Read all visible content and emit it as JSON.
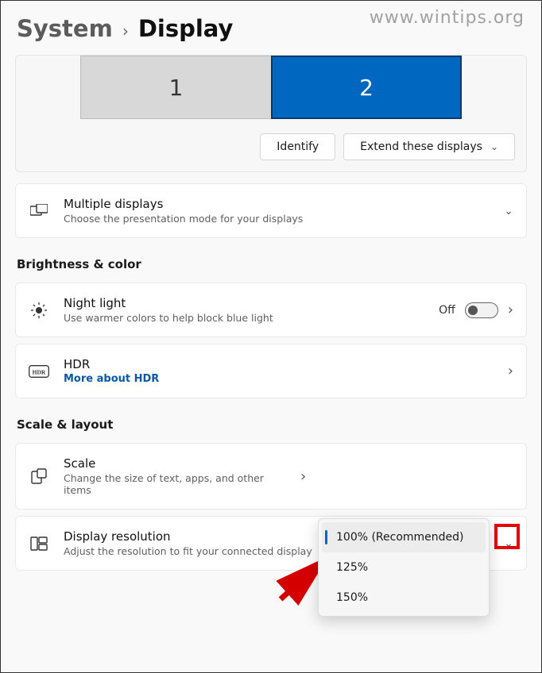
{
  "watermark": "www.wintips.org",
  "breadcrumb": {
    "system": "System",
    "display": "Display"
  },
  "monitors": {
    "m1": "1",
    "m2": "2",
    "identify": "Identify",
    "extend": "Extend these displays"
  },
  "sections": {
    "brightness": "Brightness & color",
    "scale": "Scale & layout"
  },
  "multiple": {
    "title": "Multiple displays",
    "sub": "Choose the presentation mode for your displays"
  },
  "night": {
    "title": "Night light",
    "sub": "Use warmer colors to help block blue light",
    "state": "Off"
  },
  "hdr": {
    "title": "HDR",
    "link": "More about HDR"
  },
  "scaleCard": {
    "title": "Scale",
    "sub": "Change the size of text, apps, and other items"
  },
  "resolution": {
    "title": "Display resolution",
    "sub": "Adjust the resolution to fit your connected display"
  },
  "scaleOptions": {
    "o1": "100% (Recommended)",
    "o2": "125%",
    "o3": "150%"
  }
}
